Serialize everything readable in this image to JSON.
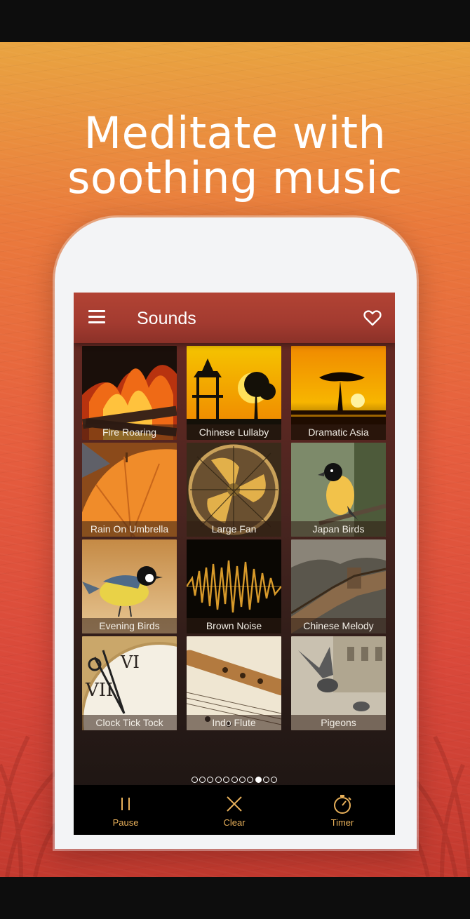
{
  "promo": {
    "headline_line1": "Meditate with",
    "headline_line2": "soothing music"
  },
  "app": {
    "title": "Sounds",
    "menu_icon": "hamburger-menu-icon",
    "favorite_icon": "heart-outline-icon"
  },
  "sounds": [
    {
      "label": "Fire Roaring",
      "icon": "fire-image"
    },
    {
      "label": "Chinese Lullaby",
      "icon": "pagoda-sunset-image"
    },
    {
      "label": "Dramatic Asia",
      "icon": "acacia-sunset-image"
    },
    {
      "label": "Rain On Umbrella",
      "icon": "umbrella-image"
    },
    {
      "label": "Large Fan",
      "icon": "fan-image"
    },
    {
      "label": "Japan Birds",
      "icon": "bird-on-branch-image"
    },
    {
      "label": "Evening Birds",
      "icon": "titmouse-image"
    },
    {
      "label": "Brown Noise",
      "icon": "waveform-image"
    },
    {
      "label": "Chinese Melody",
      "icon": "great-wall-image"
    },
    {
      "label": "Clock Tick Tock",
      "icon": "clock-image"
    },
    {
      "label": "Indo Flute",
      "icon": "flute-image"
    },
    {
      "label": "Pigeons",
      "icon": "pigeons-image"
    }
  ],
  "pager": {
    "total": 11,
    "active_index": 8
  },
  "controls": {
    "pause_label": "Pause",
    "clear_label": "Clear",
    "timer_label": "Timer",
    "accent_color": "#e8b05a"
  }
}
